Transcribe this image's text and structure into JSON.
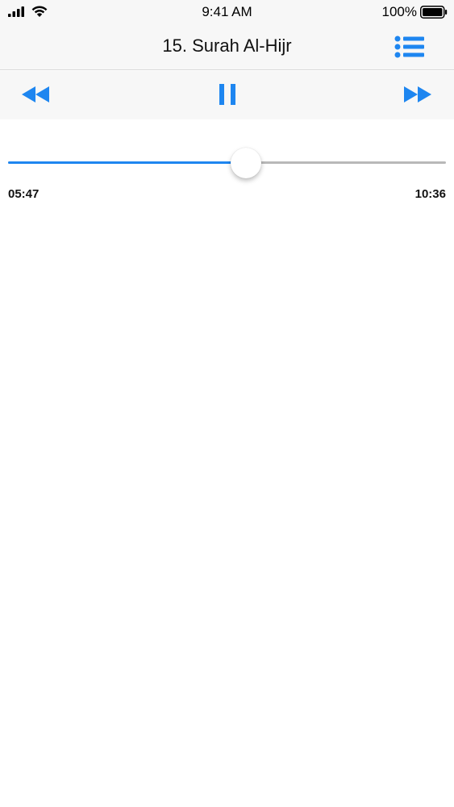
{
  "status_bar": {
    "time": "9:41 AM",
    "battery_percent": "100%",
    "icons": [
      "cellular-signal-icon",
      "wifi-icon",
      "battery-icon"
    ]
  },
  "nav": {
    "title": "15. Surah Al-Hijr",
    "list_icon": "list-icon"
  },
  "controls": {
    "rewind_icon": "rewind-icon",
    "pause_icon": "pause-icon",
    "forward_icon": "fast-forward-icon"
  },
  "player": {
    "elapsed": "05:47",
    "duration": "10:36",
    "progress": 0.544
  },
  "colors": {
    "accent": "#1e86f0",
    "bar_background": "#f7f7f7",
    "track": "#b8b8b8"
  }
}
